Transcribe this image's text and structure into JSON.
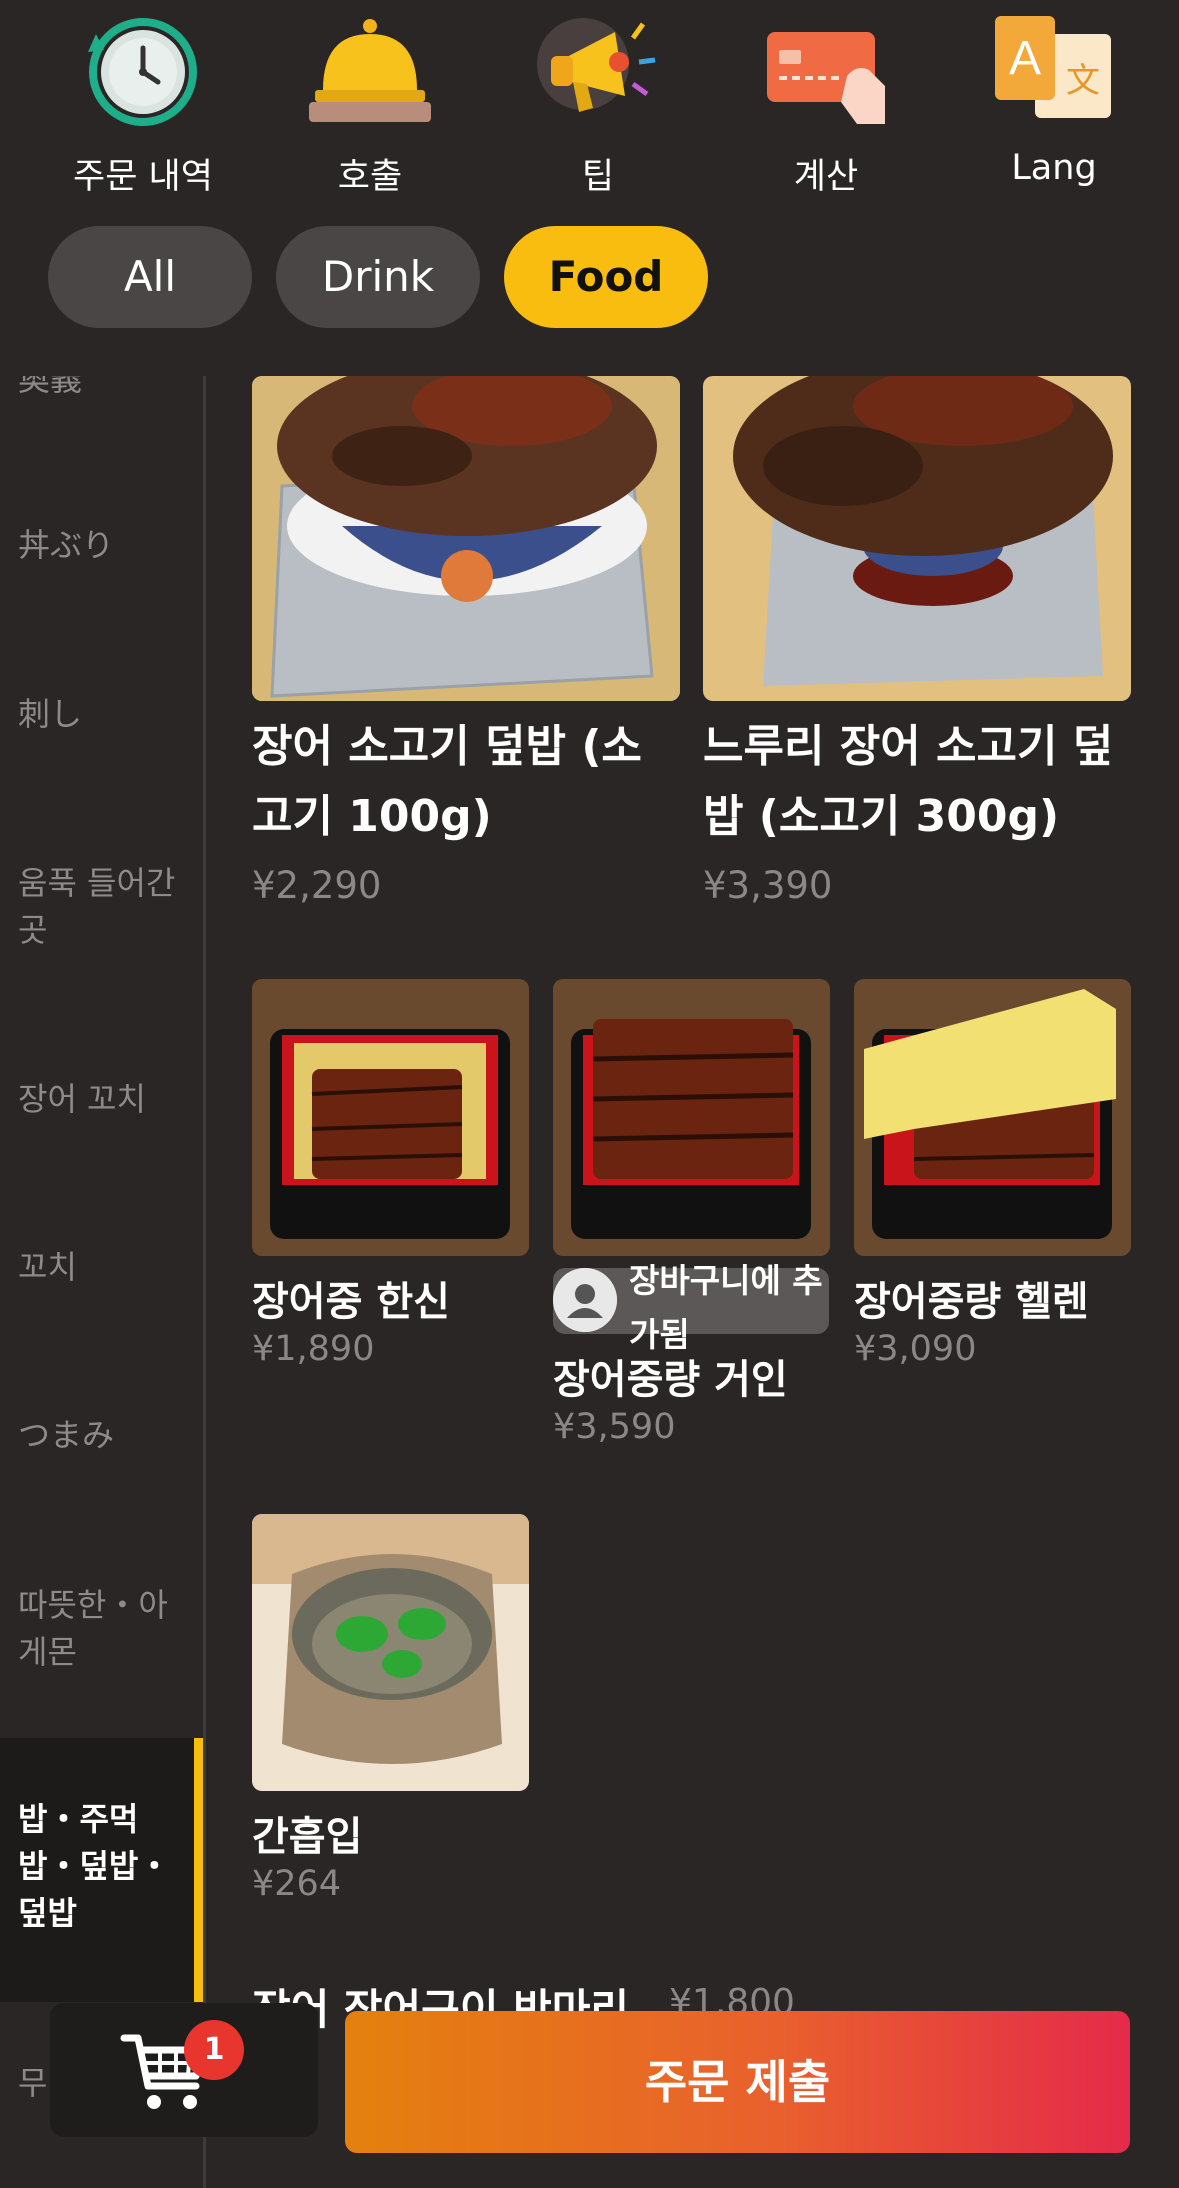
{
  "top_actions": [
    {
      "label": "주문 내역",
      "icon": "clock-icon"
    },
    {
      "label": "호출",
      "icon": "service-bell-icon"
    },
    {
      "label": "팁",
      "icon": "megaphone-icon"
    },
    {
      "label": "계산",
      "icon": "credit-card-icon"
    },
    {
      "label": "Lang",
      "icon": "translate-icon"
    }
  ],
  "filters": [
    {
      "label": "All",
      "active": false
    },
    {
      "label": "Drink",
      "active": false
    },
    {
      "label": "Food",
      "active": true
    }
  ],
  "sidebar": {
    "items": [
      {
        "label": "奥義"
      },
      {
        "label": "丼ぶり"
      },
      {
        "label": "刺し"
      },
      {
        "label": "움푹 들어간 곳"
      },
      {
        "label": "장어 꼬치"
      },
      {
        "label": "꼬치"
      },
      {
        "label": "つまみ"
      },
      {
        "label": "따뜻한・아게몬"
      },
      {
        "label": "밥・주먹밥・덮밥・덮밥",
        "active": true
      },
      {
        "label": "무"
      }
    ]
  },
  "menu": {
    "row1": [
      {
        "name": "장어 소고기 덮밥 (소고기 100g)",
        "price": "¥2,290"
      },
      {
        "name": "느루리 장어 소고기 덮밥 (소고기 300g)",
        "price": "¥3,390"
      }
    ],
    "row2": [
      {
        "name": "장어중 한신",
        "price": "¥1,890"
      },
      {
        "name": "장어중량 거인",
        "price": "¥3,590"
      },
      {
        "name": "장어중량 헬렌",
        "price": "¥3,090"
      }
    ],
    "row3": [
      {
        "name": "간흡입",
        "price": "¥264"
      }
    ],
    "peek_item": {
      "name": "장어 장어구이 반마리",
      "price": "¥1,800"
    }
  },
  "toast": {
    "text": "장바구니에 추가됨",
    "icon": "user-avatar-icon"
  },
  "cart": {
    "count": "1",
    "icon": "shopping-cart-icon"
  },
  "submit_label": "주문 제출",
  "colors": {
    "accent": "#f9bd0f",
    "background": "#2a2626",
    "badge": "#e8362f"
  }
}
